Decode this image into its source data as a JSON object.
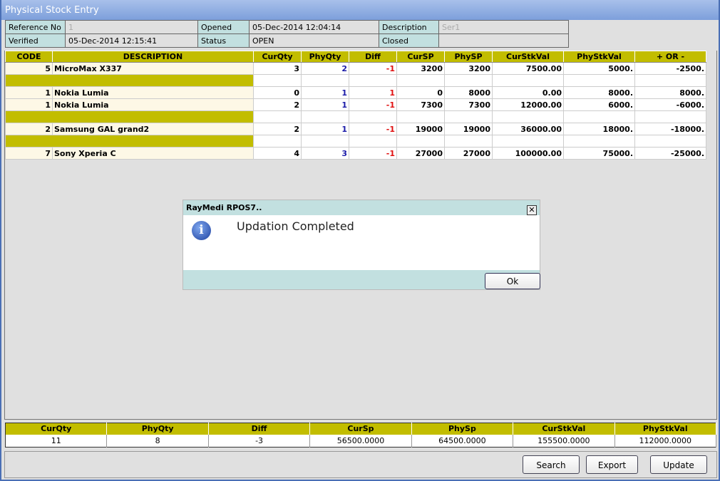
{
  "window": {
    "title": "Physical Stock Entry"
  },
  "info": {
    "ref_label": "Reference No",
    "ref_value": "1",
    "opened_label": "Opened",
    "opened_value": "05-Dec-2014 12:04:14",
    "desc_label": "Description",
    "desc_value": "Ser1",
    "verified_label": "Verified",
    "verified_value": "05-Dec-2014 12:15:41",
    "status_label": "Status",
    "status_value": "OPEN",
    "closed_label": "Closed",
    "closed_value": ""
  },
  "grid": {
    "headers": [
      "CODE",
      "DESCRIPTION",
      "CurQty",
      "PhyQty",
      "Diff",
      "CurSP",
      "PhySP",
      "CurStkVal",
      "PhyStkVal",
      "+ OR -"
    ],
    "rows": [
      [
        "5",
        "MicroMax X337",
        "3",
        "2",
        "-1",
        "3200",
        "3200",
        "7500.00",
        "5000.",
        "-2500."
      ],
      null,
      [
        "1",
        "Nokia Lumia",
        "0",
        "1",
        "1",
        "0",
        "8000",
        "0.00",
        "8000.",
        "8000."
      ],
      [
        "1",
        "Nokia Lumia",
        "2",
        "1",
        "-1",
        "7300",
        "7300",
        "12000.00",
        "6000.",
        "-6000."
      ],
      null,
      [
        "2",
        "Samsung GAL grand2",
        "2",
        "1",
        "-1",
        "19000",
        "19000",
        "36000.00",
        "18000.",
        "-18000."
      ],
      null,
      [
        "7",
        "Sony Xperia C",
        "4",
        "3",
        "-1",
        "27000",
        "27000",
        "100000.00",
        "75000.",
        "-25000."
      ]
    ]
  },
  "totals": {
    "headers": [
      "CurQty",
      "PhyQty",
      "Diff",
      "CurSp",
      "PhySp",
      "CurStkVal",
      "PhyStkVal"
    ],
    "values": [
      "11",
      "8",
      "-3",
      "56500.0000",
      "64500.0000",
      "155500.0000",
      "112000.0000"
    ]
  },
  "buttons": {
    "search": "Search",
    "export": "Export",
    "update": "Update"
  },
  "dialog": {
    "title": "RayMedi RPOS7..",
    "message": "Updation Completed",
    "ok": "Ok",
    "close": "✕"
  }
}
